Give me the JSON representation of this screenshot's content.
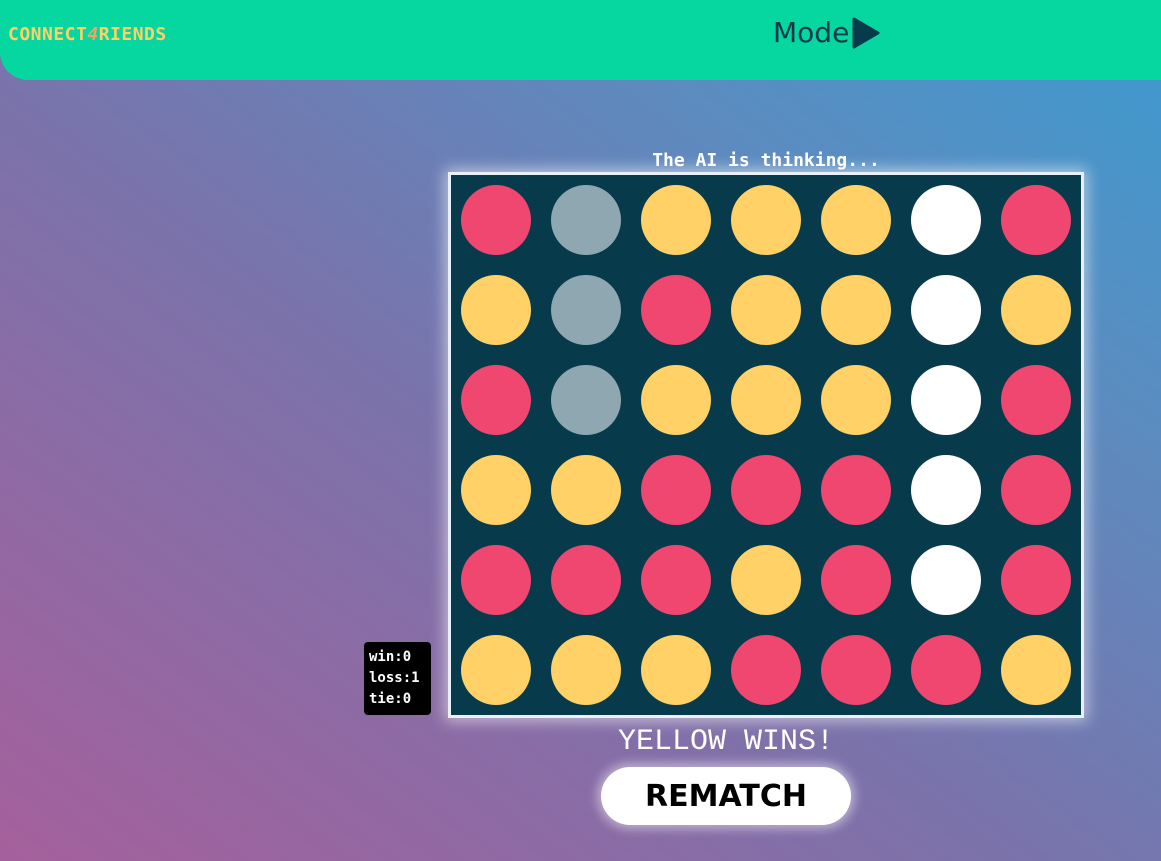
{
  "header": {
    "logo_prefix": "CONNECT",
    "logo_four": "4",
    "logo_suffix": "RIENDS",
    "mode_label": "Mode",
    "mode_icon": "play-icon"
  },
  "game": {
    "status_text": "The AI is thinking...",
    "columns": 7,
    "rows": 6,
    "colors": {
      "board": "#073b4c",
      "red": "#ef476f",
      "yellow": "#ffd166",
      "white": "#ffffff",
      "gray": "#8ea7b0"
    },
    "grid": [
      [
        "red",
        "gray",
        "yellow",
        "yellow",
        "yellow",
        "white",
        "red"
      ],
      [
        "yellow",
        "gray",
        "red",
        "yellow",
        "yellow",
        "white",
        "yellow"
      ],
      [
        "red",
        "gray",
        "yellow",
        "yellow",
        "yellow",
        "white",
        "red"
      ],
      [
        "yellow",
        "yellow",
        "red",
        "red",
        "red",
        "white",
        "red"
      ],
      [
        "red",
        "red",
        "red",
        "yellow",
        "red",
        "white",
        "red"
      ],
      [
        "yellow",
        "yellow",
        "yellow",
        "red",
        "red",
        "red",
        "yellow"
      ]
    ],
    "result_text": "YELLOW WINS!",
    "rematch_label": "REMATCH"
  },
  "scoreboard": {
    "win_label": "win:",
    "win": "0",
    "loss_label": "loss:",
    "loss": "1",
    "tie_label": "tie:",
    "tie": "0"
  }
}
